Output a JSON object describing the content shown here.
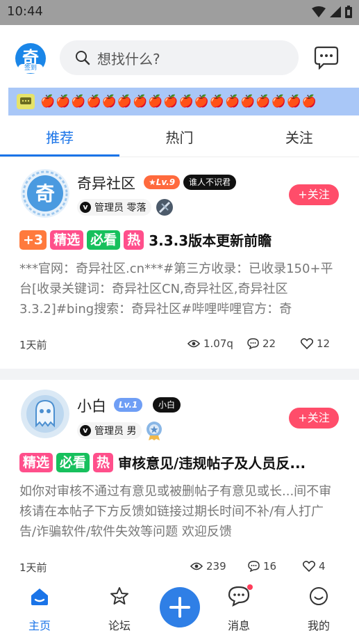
{
  "status_bar": {
    "time": "10:44"
  },
  "header": {
    "logo_char": "奇",
    "logo_sign": "签到",
    "search_placeholder": "想找什么?",
    "search_icon": "search-icon",
    "message_icon": "chat-bubble-icon"
  },
  "banner": {
    "apples": "🍎🍎🍎🍎🍎🍎🍎🍎🍎🍎🍎🍎🍎🍎🍎🍎🍎🍎"
  },
  "tabs": [
    {
      "label": "推荐",
      "active": true
    },
    {
      "label": "热门",
      "active": false
    },
    {
      "label": "关注",
      "active": false
    }
  ],
  "posts": [
    {
      "author": "奇异社区",
      "level": "★Lv.9",
      "level_color": "#ff6a3d",
      "title_tag": "谁人不识君",
      "role": "管理员 零落",
      "follow": "+关注",
      "badges": [
        "+3",
        "精选",
        "必看",
        "热"
      ],
      "title": "3.3.3版本更新前瞻",
      "body": "***官网：奇异社区.cn***#第三方收录：已收录150+平台[收录关键词：奇异社区CN,奇异社区,奇异社区3.3.2]#bing搜索：奇异社区#哔哩哔哩官方：奇",
      "time": "1天前",
      "views": "1.07q",
      "comments": "22",
      "likes": "12"
    },
    {
      "author": "小白",
      "level": "Lv.1",
      "level_color": "#6f9ef5",
      "title_tag": "小白",
      "role": "管理员 男",
      "follow": "+关注",
      "badges": [
        "精选",
        "必看",
        "热"
      ],
      "title": "审核意见/违规帖子及人员反...",
      "body": "如你对审核不通过有意见或被删帖子有意见或长...间不审核请在本帖子下方反馈如链接过期长时间不补/有人打广告/诈骗软件/软件失效等问题 欢迎反馈",
      "time": "1天前",
      "views": "239",
      "comments": "16",
      "likes": "4"
    }
  ],
  "bottom_nav": [
    {
      "label": "主页",
      "icon": "home-icon",
      "active": true
    },
    {
      "label": "论坛",
      "icon": "star-icon",
      "active": false
    },
    {
      "label": "",
      "icon": "plus-icon",
      "active": false
    },
    {
      "label": "消息",
      "icon": "message-icon",
      "active": false
    },
    {
      "label": "我的",
      "icon": "smile-icon",
      "active": false
    }
  ],
  "colors": {
    "accent": "#1a74e8",
    "follow": "#ff4d6a"
  }
}
